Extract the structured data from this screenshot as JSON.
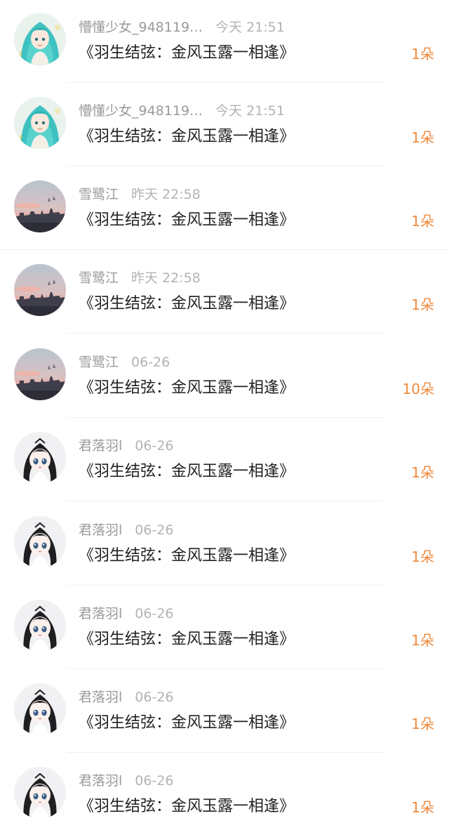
{
  "colors": {
    "count": "#f08a3c",
    "meta": "#9a9a9a",
    "title": "#222222"
  },
  "items": [
    {
      "name": "懵懂少女_948119…",
      "time": "今天 21:51",
      "title": "《羽生结弦：金风玉露一相逢》",
      "count": "1朵",
      "avatar": "anime-girl-teal-hair"
    },
    {
      "name": "懵懂少女_948119…",
      "time": "今天 21:51",
      "title": "《羽生结弦：金风玉露一相逢》",
      "count": "1朵",
      "avatar": "anime-girl-teal-hair"
    },
    {
      "name": "雪鹭江",
      "time": "昨天 22:58",
      "title": "《羽生结弦：金风玉露一相逢》",
      "count": "1朵",
      "avatar": "sunset-city"
    },
    {
      "name": "雪鹭江",
      "time": "昨天 22:58",
      "title": "《羽生结弦：金风玉露一相逢》",
      "count": "1朵",
      "avatar": "sunset-city"
    },
    {
      "name": "雪鹭江",
      "time": "06-26",
      "title": "《羽生结弦：金风玉露一相逢》",
      "count": "10朵",
      "avatar": "sunset-city"
    },
    {
      "name": "君落羽l",
      "time": "06-26",
      "title": "《羽生结弦：金风玉露一相逢》",
      "count": "1朵",
      "avatar": "chibi-character-black-hair"
    },
    {
      "name": "君落羽l",
      "time": "06-26",
      "title": "《羽生结弦：金风玉露一相逢》",
      "count": "1朵",
      "avatar": "chibi-character-black-hair"
    },
    {
      "name": "君落羽l",
      "time": "06-26",
      "title": "《羽生结弦：金风玉露一相逢》",
      "count": "1朵",
      "avatar": "chibi-character-black-hair"
    },
    {
      "name": "君落羽l",
      "time": "06-26",
      "title": "《羽生结弦：金风玉露一相逢》",
      "count": "1朵",
      "avatar": "chibi-character-black-hair"
    },
    {
      "name": "君落羽l",
      "time": "06-26",
      "title": "《羽生结弦：金风玉露一相逢》",
      "count": "1朵",
      "avatar": "chibi-character-black-hair"
    }
  ]
}
